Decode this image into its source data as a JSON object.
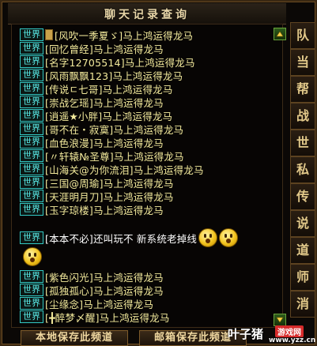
{
  "window": {
    "title": "聊天记录查询"
  },
  "chat": {
    "messages": [
      {
        "channel": "世界",
        "text": "[风吹一季夏ゞ]马上鸿运得龙马",
        "pinned": true
      },
      {
        "channel": "世界",
        "text": "[回忆曾经]马上鸿运得龙马"
      },
      {
        "channel": "世界",
        "text": "[名字12705514]马上鸿运得龙马"
      },
      {
        "channel": "世界",
        "text": "[风雨飘飘123]马上鸿运得龙马"
      },
      {
        "channel": "世界",
        "text": "[传说ㄷ七哥]马上鸿运得龙马"
      },
      {
        "channel": "世界",
        "text": "[崇战乞瑶]马上鸿运得龙马"
      },
      {
        "channel": "世界",
        "text": "[逍遥★小胖]马上鸿运得龙马"
      },
      {
        "channel": "世界",
        "text": "[哥不在・寂寞]马上鸿运得龙马"
      },
      {
        "channel": "世界",
        "text": "[血色浪漫]马上鸿运得龙马"
      },
      {
        "channel": "世界",
        "text": "[〃轩辕№圣尊]马上鸿运得龙马"
      },
      {
        "channel": "世界",
        "text": "[山海关@为你流泪]马上鸿运得龙马"
      },
      {
        "channel": "世界",
        "text": "[三国@周瑜]马上鸿运得龙马"
      },
      {
        "channel": "世界",
        "text": "[天涯明月刀]马上鸿运得龙马"
      },
      {
        "channel": "世界",
        "text": "[玉字琼楼]马上鸿运得龙马"
      },
      {
        "channel": "世界",
        "text": "[本本不必]还叫玩不 新系统老掉线"
      },
      {
        "channel": "世界",
        "text": "[紫色闪光]马上鸿运得龙马"
      },
      {
        "channel": "世界",
        "text": "[孤独孤心]马上鸿运得龙马"
      },
      {
        "channel": "世界",
        "text": "[尘缘念]马上鸿运得龙马"
      },
      {
        "channel": "世界",
        "text": "[╋醉梦〆醒]马上鸿运得龙马"
      }
    ]
  },
  "side_tabs": [
    "队",
    "当",
    "帮",
    "战",
    "世",
    "私",
    "传",
    "说",
    "道",
    "师",
    "消"
  ],
  "buttons": {
    "save_local": "本地保存此频道",
    "save_mail": "邮箱保存此频道"
  },
  "watermark": {
    "main": "叶子猪",
    "badge": "游戏网",
    "url": "www.yzz.cn"
  },
  "icons": {
    "scroll_up": "scroll-up-arrow-icon",
    "scroll_down": "scroll-down-arrow-icon",
    "emoji": "shocked-face-emoji-icon"
  },
  "colors": {
    "channel_tag": "#33c9c4",
    "message_text": "#f3ea9c",
    "panel_border": "#6b4a22"
  }
}
